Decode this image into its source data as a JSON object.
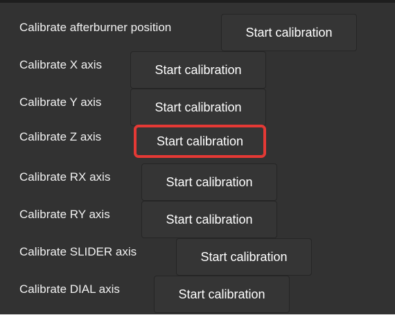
{
  "calibration": {
    "rows": [
      {
        "label": "Calibrate afterburner position",
        "button": "Start calibration"
      },
      {
        "label": "Calibrate X axis",
        "button": "Start calibration"
      },
      {
        "label": "Calibrate Y axis",
        "button": "Start calibration"
      },
      {
        "label": "Calibrate Z axis",
        "button": "Start calibration",
        "highlighted": true
      },
      {
        "label": "Calibrate RX axis",
        "button": "Start calibration"
      },
      {
        "label": "Calibrate RY axis",
        "button": "Start calibration"
      },
      {
        "label": "Calibrate SLIDER axis",
        "button": "Start calibration"
      },
      {
        "label": "Calibrate DIAL axis",
        "button": "Start calibration"
      }
    ],
    "highlight_color": "#e53935"
  }
}
